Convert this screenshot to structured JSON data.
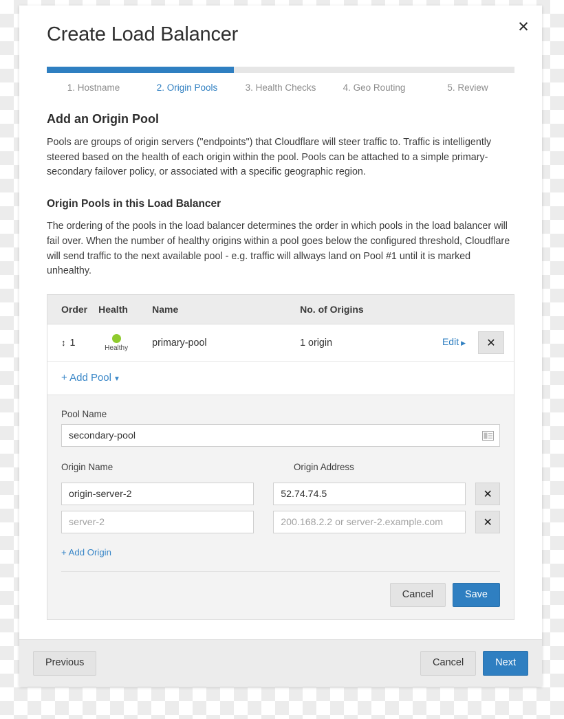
{
  "modal": {
    "title": "Create Load Balancer",
    "close_icon": "close-icon"
  },
  "wizard": {
    "progress_percent": 40,
    "steps": [
      {
        "label": "1. Hostname",
        "active": false
      },
      {
        "label": "2. Origin Pools",
        "active": true
      },
      {
        "label": "3. Health Checks",
        "active": false
      },
      {
        "label": "4. Geo Routing",
        "active": false
      },
      {
        "label": "5. Review",
        "active": false
      }
    ]
  },
  "intro": {
    "heading": "Add an Origin Pool",
    "paragraph": "Pools are groups of origin servers (\"endpoints\") that Cloudflare will steer traffic to. Traffic is intelligently steered based on the health of each origin within the pool. Pools can be attached to a simple primary-secondary failover policy, or associated with a specific geographic region."
  },
  "pools_section": {
    "heading": "Origin Pools in this Load Balancer",
    "paragraph": "The ordering of the pools in the load balancer determines the order in which pools in the load balancer will fail over. When the number of healthy origins within a pool goes below the configured threshold, Cloudflare will send traffic to the next available pool - e.g. traffic will allways land on Pool #1 until it is marked unhealthy."
  },
  "pools_table": {
    "columns": [
      "Order",
      "Health",
      "Name",
      "No. of Origins"
    ],
    "rows": [
      {
        "order": "1",
        "sort_handle": "↕",
        "health_status": "Healthy",
        "health_color": "#8fcb2e",
        "name": "primary-pool",
        "origins": "1 origin",
        "edit_label": "Edit",
        "edit_caret": "▶",
        "delete_icon": "✕"
      }
    ],
    "add_pool_label": "+ Add Pool",
    "add_pool_caret": "▼"
  },
  "pool_form": {
    "pool_name_label": "Pool Name",
    "pool_name_value": "secondary-pool",
    "pool_name_placeholder": "Pool Name",
    "pool_name_icon": "contact-card-icon",
    "origin_name_label": "Origin Name",
    "origin_address_label": "Origin Address",
    "origins": [
      {
        "name_value": "origin-server-2",
        "name_placeholder": "",
        "address_value": "52.74.74.5",
        "address_placeholder": "",
        "delete_icon": "✕"
      },
      {
        "name_value": "",
        "name_placeholder": "server-2",
        "address_value": "",
        "address_placeholder": "200.168.2.2 or server-2.example.com",
        "delete_icon": "✕"
      }
    ],
    "add_origin_label": "+ Add Origin",
    "cancel_label": "Cancel",
    "save_label": "Save"
  },
  "footer": {
    "previous_label": "Previous",
    "cancel_label": "Cancel",
    "next_label": "Next"
  },
  "colors": {
    "accent": "#2f7fc1",
    "link": "#3a87c8",
    "healthy": "#8fcb2e",
    "header_bg": "#ececec",
    "form_bg": "#f3f3f3"
  }
}
